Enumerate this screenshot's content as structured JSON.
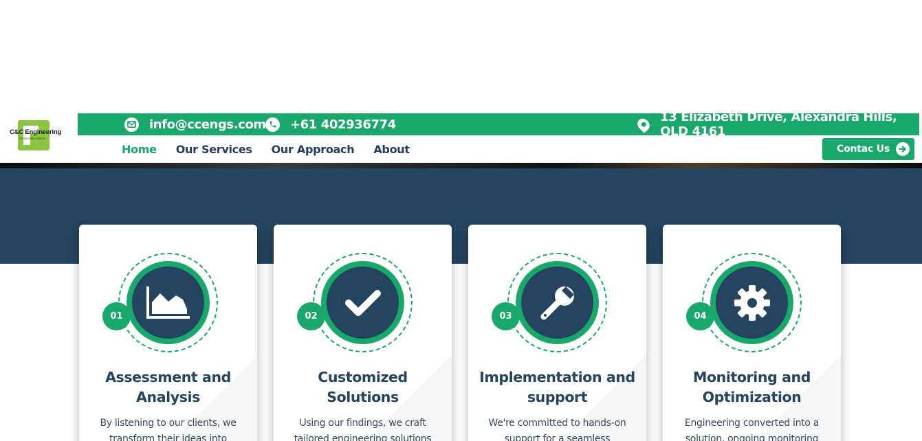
{
  "brand": {
    "name": "C&C Engineering",
    "tagline": "CONSULTING CRAFTS",
    "logo_color": "#8bc53f"
  },
  "colors": {
    "accent": "#17a86a",
    "navy": "#24445f"
  },
  "contact_bar": {
    "email": "info@ccengs.com",
    "phone": "+61 402936774",
    "address": "13 Elizabeth Drive, Alexandra Hills, QLD 4161"
  },
  "nav": {
    "items": [
      {
        "label": "Home",
        "active": true
      },
      {
        "label": "Our Services"
      },
      {
        "label": "Our Approach"
      },
      {
        "label": "About"
      }
    ],
    "cta_label": "Contac Us"
  },
  "cards": [
    {
      "number": "01",
      "icon": "area-chart-icon",
      "title": "Assessment and Analysis",
      "text": "By listening to our clients, we transform their ideas into"
    },
    {
      "number": "02",
      "icon": "checkmark-icon",
      "title": "Customized Solutions",
      "text": "Using our findings, we craft tailored engineering solutions to"
    },
    {
      "number": "03",
      "icon": "wrench-icon",
      "title": "Implementation and support",
      "text": "We're committed to hands-on support for a seamless"
    },
    {
      "number": "04",
      "icon": "gear-icon",
      "title": "Monitoring and Optimization",
      "text": "Engineering converted into a solution, ongoing monitoring"
    }
  ]
}
